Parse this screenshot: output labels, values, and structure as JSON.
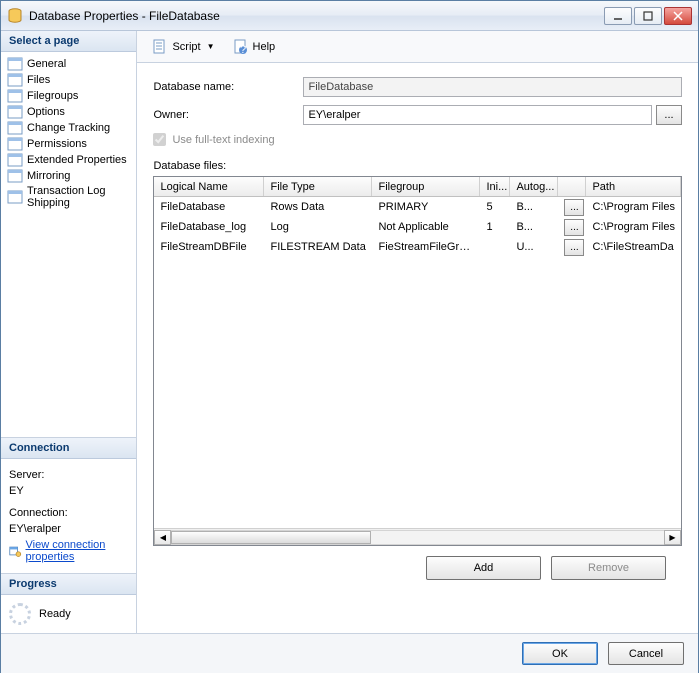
{
  "window": {
    "title": "Database Properties - FileDatabase"
  },
  "sidebar": {
    "pagesHeader": "Select a page",
    "pages": [
      {
        "label": "General"
      },
      {
        "label": "Files"
      },
      {
        "label": "Filegroups"
      },
      {
        "label": "Options"
      },
      {
        "label": "Change Tracking"
      },
      {
        "label": "Permissions"
      },
      {
        "label": "Extended Properties"
      },
      {
        "label": "Mirroring"
      },
      {
        "label": "Transaction Log Shipping"
      }
    ],
    "connection": {
      "header": "Connection",
      "serverLabel": "Server:",
      "server": "EY",
      "connLabel": "Connection:",
      "conn": "EY\\eralper",
      "viewLink": "View connection properties"
    },
    "progress": {
      "header": "Progress",
      "status": "Ready"
    }
  },
  "toolbar": {
    "script": "Script",
    "help": "Help"
  },
  "form": {
    "dbNameLabel": "Database name:",
    "dbName": "FileDatabase",
    "ownerLabel": "Owner:",
    "owner": "EY\\eralper",
    "fulltextLabel": "Use full-text indexing",
    "filesLabel": "Database files:"
  },
  "grid": {
    "headers": [
      "Logical Name",
      "File Type",
      "Filegroup",
      "Ini...",
      "Autog...",
      "",
      "Path"
    ],
    "rows": [
      {
        "name": "FileDatabase",
        "type": "Rows Data",
        "fg": "PRIMARY",
        "ini": "5",
        "autog": "B...",
        "path": "C:\\Program Files"
      },
      {
        "name": "FileDatabase_log",
        "type": "Log",
        "fg": "Not Applicable",
        "ini": "1",
        "autog": "B...",
        "path": "C:\\Program Files"
      },
      {
        "name": "FileStreamDBFile",
        "type": "FILESTREAM Data",
        "fg": "FieStreamFileGroup",
        "ini": "",
        "autog": "U...",
        "path": "C:\\FileStreamDa"
      }
    ]
  },
  "buttons": {
    "add": "Add",
    "remove": "Remove",
    "ok": "OK",
    "cancel": "Cancel",
    "ellipsis": "..."
  }
}
